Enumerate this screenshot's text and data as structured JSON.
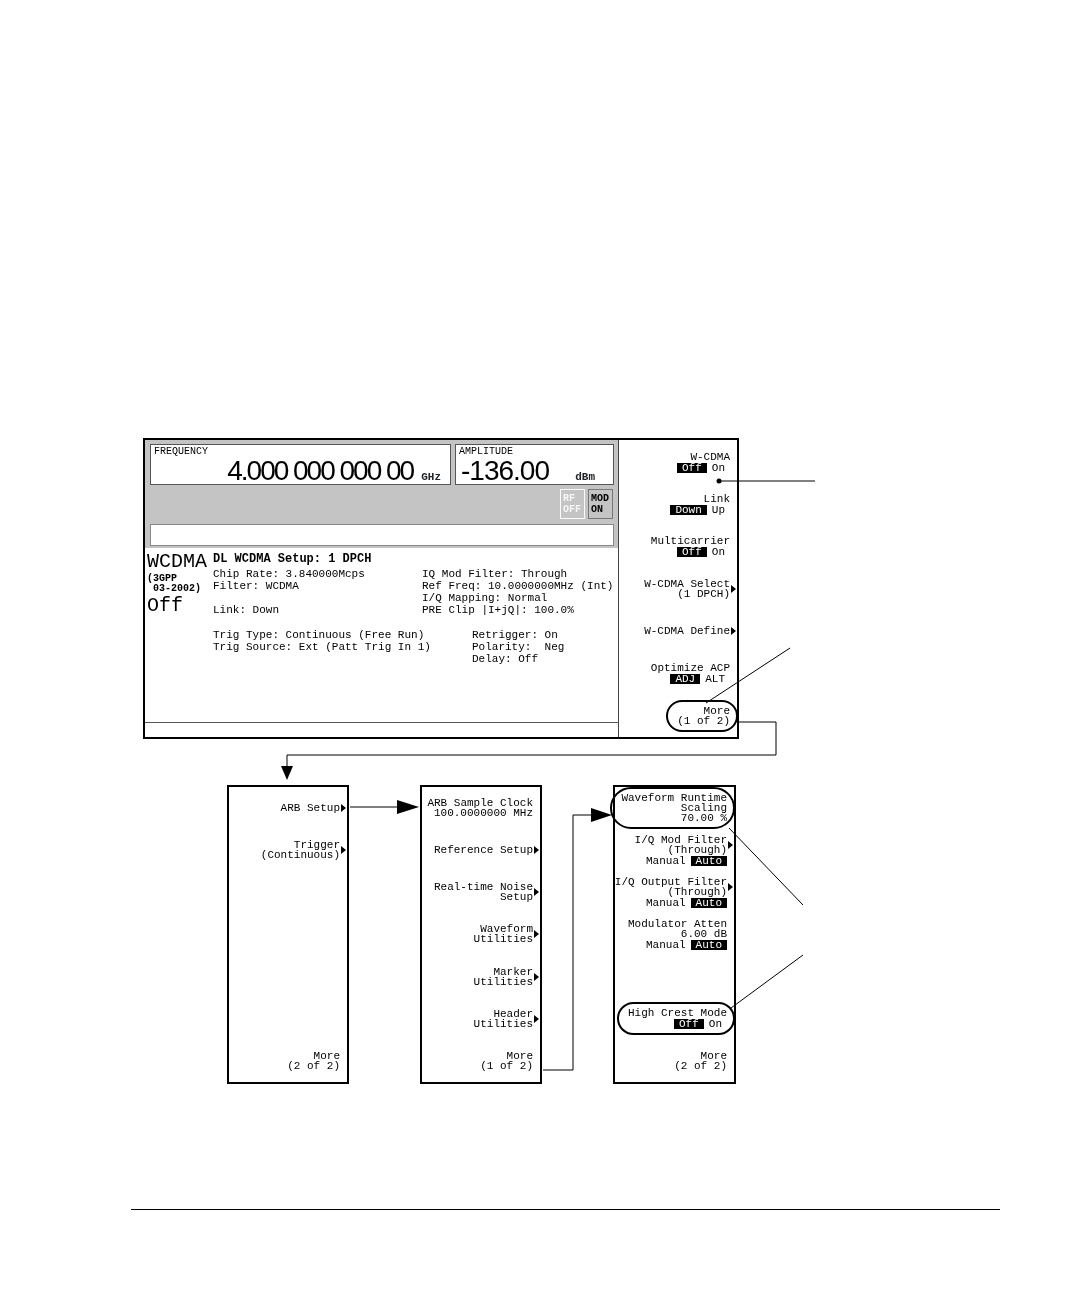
{
  "display": {
    "frequency": {
      "label": "FREQUENCY",
      "value": "4.000 000 000 00",
      "unit": "GHz"
    },
    "amplitude": {
      "label": "AMPLITUDE",
      "value": "-136.00",
      "unit": "dBm"
    },
    "indicators": [
      {
        "lines": [
          "RF",
          "OFF"
        ],
        "on": false
      },
      {
        "lines": [
          "MOD",
          "ON"
        ],
        "on": true
      }
    ],
    "mode": {
      "name": "WCDMA",
      "standard": [
        "(3GPP",
        "03-2002)"
      ],
      "state": "Off"
    },
    "setup_title": "DL WCDMA Setup: 1 DPCH",
    "settings_left": [
      [
        "Chip Rate: 3.840000Mcps",
        "Filter: WCDMA"
      ],
      [
        "Link: Down"
      ]
    ],
    "settings_right": [
      "IQ Mod Filter: Through",
      "Ref Freq: 10.0000000MHz (Int)",
      "I/Q Mapping: Normal",
      "PRE Clip |I+jQ|: 100.0%"
    ],
    "trigger_left": [
      "Trig Type: Continuous (Free Run)",
      "Trig Source: Ext (Patt Trig In 1)"
    ],
    "trigger_right": [
      "Retrigger: On",
      "Polarity:  Neg",
      "Delay: Off"
    ],
    "softkeys": [
      {
        "kind": "softkey",
        "lines": [
          "W-CDMA"
        ],
        "arrow": false,
        "circled": false,
        "options": [
          {
            "text": "Off",
            "selected": true
          },
          {
            "text": "On",
            "selected": false
          }
        ]
      },
      {
        "kind": "softkey",
        "lines": [
          "Link"
        ],
        "arrow": false,
        "circled": false,
        "options": [
          {
            "text": "Down",
            "selected": true
          },
          {
            "text": "Up",
            "selected": false
          }
        ]
      },
      {
        "kind": "softkey",
        "lines": [
          "Multicarrier"
        ],
        "arrow": false,
        "circled": false,
        "options": [
          {
            "text": "Off",
            "selected": true
          },
          {
            "text": "On",
            "selected": false
          }
        ]
      },
      {
        "kind": "softkey",
        "lines": [
          "W-CDMA Select",
          "(1 DPCH)"
        ],
        "arrow": true,
        "circled": false
      },
      {
        "kind": "softkey",
        "lines": [
          "W-CDMA Define"
        ],
        "arrow": true,
        "circled": false
      },
      {
        "kind": "softkey",
        "lines": [
          "Optimize ACP"
        ],
        "arrow": false,
        "circled": false,
        "options": [
          {
            "text": "ADJ",
            "selected": true
          },
          {
            "text": "ALT",
            "selected": false
          }
        ]
      },
      {
        "kind": "softkey",
        "lines": [
          "More",
          "(1 of 2)"
        ],
        "arrow": false,
        "circled": true
      }
    ]
  },
  "menus": [
    {
      "softkeys": [
        {
          "kind": "softkey",
          "lines": [
            "ARB Setup"
          ],
          "arrow": true,
          "circled": false
        },
        {
          "kind": "softkey",
          "lines": [
            "Trigger",
            "(Continuous)"
          ],
          "arrow": true,
          "circled": false
        },
        {
          "kind": "blank"
        },
        {
          "kind": "blank"
        },
        {
          "kind": "blank"
        },
        {
          "kind": "blank"
        },
        {
          "kind": "softkey",
          "lines": [
            "More",
            "(2 of 2)"
          ],
          "arrow": false,
          "circled": false
        }
      ]
    },
    {
      "softkeys": [
        {
          "kind": "softkey",
          "lines": [
            "ARB Sample Clock",
            "100.0000000 MHz"
          ],
          "arrow": false,
          "circled": false
        },
        {
          "kind": "softkey",
          "lines": [
            "Reference Setup"
          ],
          "arrow": true,
          "circled": false
        },
        {
          "kind": "softkey",
          "lines": [
            "Real-time Noise",
            "Setup"
          ],
          "arrow": true,
          "circled": false
        },
        {
          "kind": "softkey",
          "lines": [
            "Waveform",
            "Utilities"
          ],
          "arrow": true,
          "circled": false
        },
        {
          "kind": "softkey",
          "lines": [
            "Marker",
            "Utilities"
          ],
          "arrow": true,
          "circled": false
        },
        {
          "kind": "softkey",
          "lines": [
            "Header",
            "Utilities"
          ],
          "arrow": true,
          "circled": false
        },
        {
          "kind": "softkey",
          "lines": [
            "More",
            "(1 of 2)"
          ],
          "arrow": false,
          "circled": false
        }
      ]
    },
    {
      "softkeys": [
        {
          "kind": "softkey",
          "lines": [
            "Waveform Runtime",
            "Scaling",
            "70.00 %"
          ],
          "arrow": false,
          "circled": true
        },
        {
          "kind": "softkey",
          "lines": [
            "I/Q Mod Filter",
            "(Through)"
          ],
          "arrow": true,
          "circled": false,
          "options": [
            {
              "text": "Manual",
              "selected": false
            },
            {
              "text": "Auto",
              "selected": true
            }
          ]
        },
        {
          "kind": "softkey",
          "lines": [
            "I/Q Output Filter",
            "(Through)"
          ],
          "arrow": true,
          "circled": false,
          "options": [
            {
              "text": "Manual",
              "selected": false
            },
            {
              "text": "Auto",
              "selected": true
            }
          ]
        },
        {
          "kind": "softkey",
          "lines": [
            "Modulator Atten",
            "6.00 dB"
          ],
          "arrow": false,
          "circled": false,
          "options": [
            {
              "text": "Manual",
              "selected": false
            },
            {
              "text": "Auto",
              "selected": true
            }
          ]
        },
        {
          "kind": "blank"
        },
        {
          "kind": "softkey",
          "lines": [
            "High Crest Mode"
          ],
          "arrow": false,
          "circled": true,
          "options": [
            {
              "text": "Off",
              "selected": true
            },
            {
              "text": "On",
              "selected": false
            }
          ]
        },
        {
          "kind": "softkey",
          "lines": [
            "More",
            "(2 of 2)"
          ],
          "arrow": false,
          "circled": false
        }
      ]
    }
  ]
}
